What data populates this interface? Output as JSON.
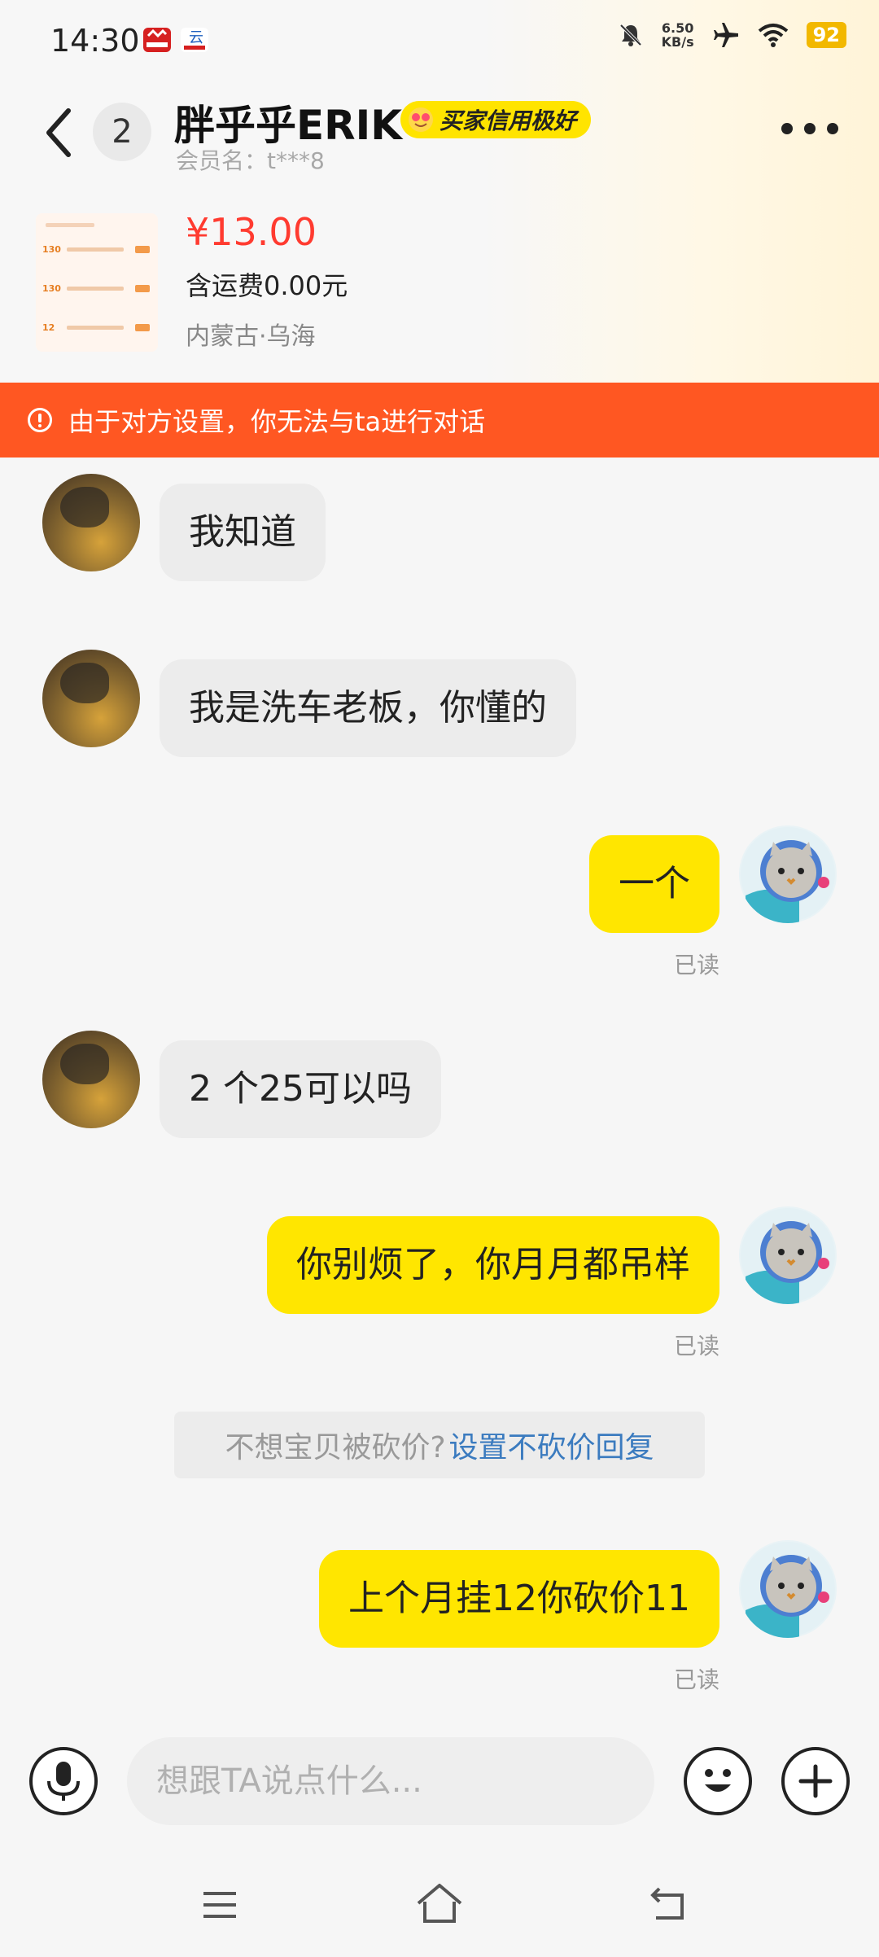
{
  "status_bar": {
    "time": "14:30",
    "speed_value": "6.50",
    "speed_unit": "KB/s",
    "battery": "92"
  },
  "header": {
    "unread_count": "2",
    "nickname": "胖乎乎ERIK",
    "credit_badge": "买家信用极好",
    "member_label": "会员名：t***8"
  },
  "product": {
    "price": "¥13.00",
    "shipping": "含运费0.00元",
    "location": "内蒙古·乌海",
    "thumb_rows": [
      "130",
      "130",
      "12"
    ]
  },
  "warning": {
    "text": "由于对方设置，你无法与ta进行对话"
  },
  "messages": [
    {
      "side": "left",
      "text": "我知道"
    },
    {
      "side": "left",
      "text": "我是洗车老板，你懂的"
    },
    {
      "side": "right",
      "text": "一个",
      "status": "已读"
    },
    {
      "side": "left",
      "text": "2 个25可以吗"
    },
    {
      "side": "right",
      "text": "你别烦了，你月月都吊样",
      "status": "已读"
    },
    {
      "side": "right",
      "text": "上个月挂12你砍价11",
      "status": "已读"
    }
  ],
  "system_hint": {
    "text": "不想宝贝被砍价?",
    "link": "设置不砍价回复"
  },
  "input": {
    "placeholder": "想跟TA说点什么..."
  },
  "colors": {
    "accent_yellow": "#ffe600",
    "warning_orange": "#ff5722",
    "price_red": "#ff3b30",
    "link_blue": "#3b7bbf"
  },
  "icons": [
    "back-arrow-icon",
    "more-icon",
    "warning-icon",
    "microphone-icon",
    "emoji-icon",
    "plus-icon",
    "menu-icon",
    "home-icon",
    "return-icon"
  ]
}
